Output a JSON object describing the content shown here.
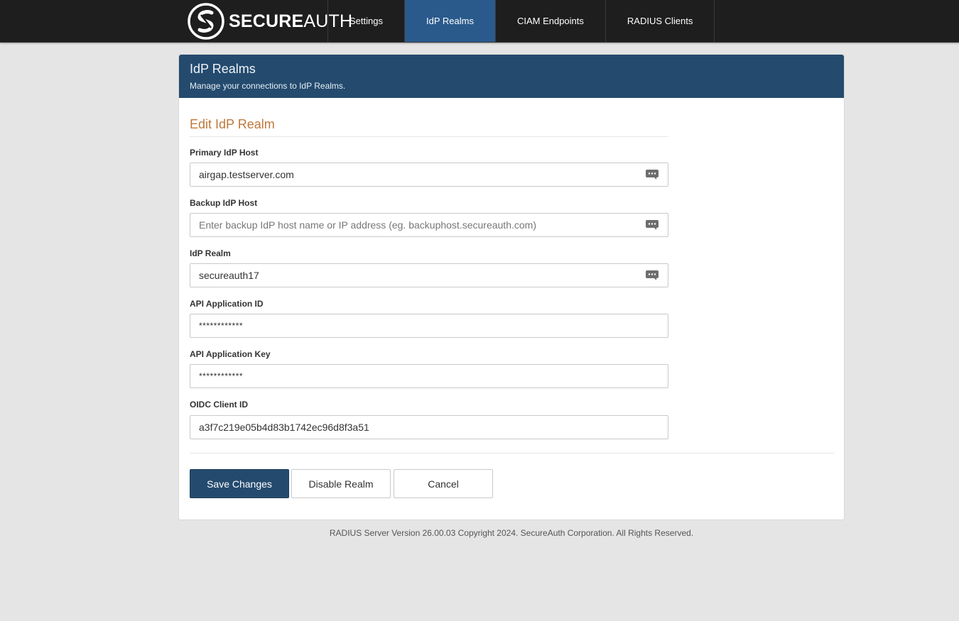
{
  "brand": {
    "name_bold": "SECURE",
    "name_light": "AUTH",
    "logo_icon": "secureauth-logo-icon"
  },
  "nav": {
    "items": [
      {
        "label": "Settings",
        "active": false
      },
      {
        "label": "IdP Realms",
        "active": true
      },
      {
        "label": "CIAM Endpoints",
        "active": false
      },
      {
        "label": "RADIUS Clients",
        "active": false
      }
    ]
  },
  "panel": {
    "title": "IdP Realms",
    "subtitle": "Manage your connections to IdP Realms."
  },
  "form": {
    "section_title": "Edit IdP Realm",
    "primary_host": {
      "label": "Primary IdP Host",
      "value": "airgap.testserver.com"
    },
    "backup_host": {
      "label": "Backup IdP Host",
      "value": "",
      "placeholder": "Enter backup IdP host name or IP address (eg. backuphost.secureauth.com)"
    },
    "realm": {
      "label": "IdP Realm",
      "value": "secureauth17"
    },
    "api_app_id": {
      "label": "API Application ID",
      "value": "************"
    },
    "api_app_key": {
      "label": "API Application Key",
      "value": "************"
    },
    "oidc_client_id": {
      "label": "OIDC Client ID",
      "value": "a3f7c219e05b4d83b1742ec96d8f3a51"
    }
  },
  "buttons": {
    "save": "Save Changes",
    "disable": "Disable Realm",
    "cancel": "Cancel"
  },
  "footer": {
    "text": "RADIUS Server Version 26.00.03 Copyright 2024. SecureAuth Corporation. All Rights Reserved."
  },
  "colors": {
    "navbar": "#1e1e1e",
    "nav_active": "#2a5a8c",
    "panel_header": "#244b6e",
    "section_title": "#c0783a",
    "primary_button": "#244b6e"
  }
}
